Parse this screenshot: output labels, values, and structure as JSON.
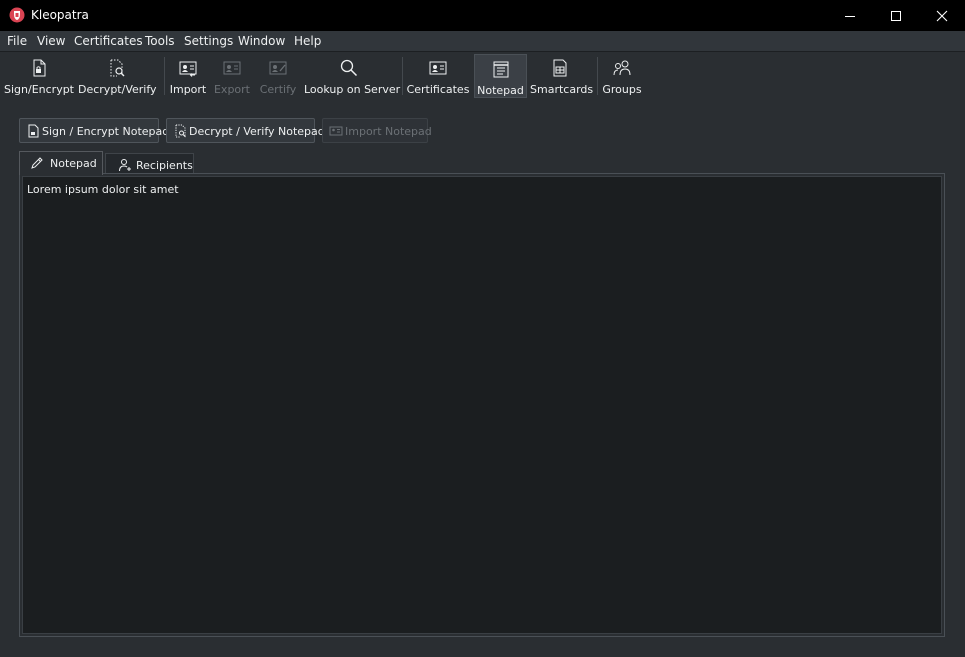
{
  "window": {
    "title": "Kleopatra",
    "controls": [
      "minimize-icon",
      "maximize-icon",
      "close-icon"
    ]
  },
  "menu": [
    "File",
    "View",
    "Certificates",
    "Tools",
    "Settings",
    "Window",
    "Help"
  ],
  "toolbar": {
    "items": [
      {
        "label": "Sign/Encrypt",
        "icon": "sign-encrypt-icon",
        "enabled": true
      },
      {
        "label": "Decrypt/Verify",
        "icon": "decrypt-verify-icon",
        "enabled": true
      },
      {
        "label": "Import",
        "icon": "import-icon",
        "enabled": true
      },
      {
        "label": "Export",
        "icon": "export-icon",
        "enabled": false
      },
      {
        "label": "Certify",
        "icon": "certify-icon",
        "enabled": false
      },
      {
        "label": "Lookup on Server",
        "icon": "search-icon",
        "enabled": true
      },
      {
        "label": "Certificates",
        "icon": "certificates-icon",
        "enabled": true
      },
      {
        "label": "Notepad",
        "icon": "notepad-icon",
        "enabled": true,
        "active": true
      },
      {
        "label": "Smartcards",
        "icon": "smartcard-icon",
        "enabled": true
      },
      {
        "label": "Groups",
        "icon": "groups-icon",
        "enabled": true
      }
    ]
  },
  "actions": {
    "sign_encrypt": "Sign / Encrypt Notepad",
    "decrypt_verify": "Decrypt / Verify Notepad",
    "import": "Import Notepad"
  },
  "tabs": [
    {
      "label": "Notepad",
      "icon": "pencil-icon",
      "active": true
    },
    {
      "label": "Recipients",
      "icon": "add-user-icon",
      "active": false
    }
  ],
  "notepad": {
    "content": "Lorem ipsum dolor sit amet"
  },
  "colors": {
    "titlebar": "#000000",
    "background": "#2a2e32",
    "editor_bg": "#1b1e20",
    "text": "#eef0f1",
    "disabled_text": "#6b7075",
    "brand_red": "#da4453"
  }
}
